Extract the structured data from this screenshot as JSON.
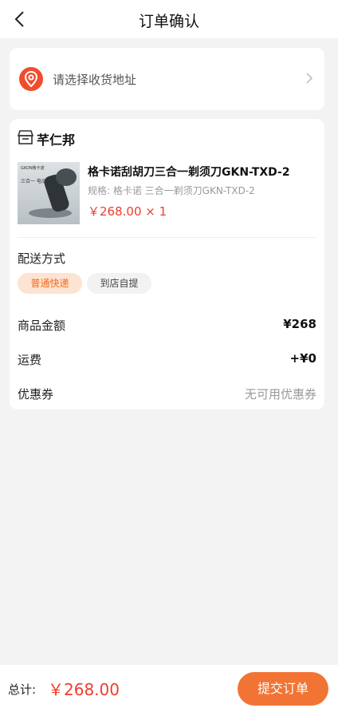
{
  "header": {
    "title": "订单确认"
  },
  "address": {
    "placeholder": "请选择收货地址"
  },
  "shop": {
    "name": "芊仁邦"
  },
  "product": {
    "thumb_brand": "GKON格卡诺",
    "thumb_caption": "三合一 电动剃须刀",
    "title": "格卡诺刮胡刀三合一剃须刀GKN-TXD-2",
    "spec": "规格:  格卡诺 三合一剃须刀GKN-TXD-2",
    "price_qty": "￥268.00  × 1"
  },
  "shipping": {
    "label": "配送方式",
    "options": [
      "普通快递",
      "到店自提"
    ],
    "selected": "普通快递"
  },
  "summary": [
    {
      "label": "商品金额",
      "value": "¥268"
    },
    {
      "label": "运费",
      "value": "+¥0"
    },
    {
      "label": "优惠券",
      "value": "无可用优惠券"
    }
  ],
  "footer": {
    "total_label": "总计:",
    "total_value": "￥268.00",
    "submit_label": "提交订单"
  },
  "colors": {
    "accent": "#ef3d2c",
    "button": "#f27434",
    "chip_selected_bg": "#fde3d1"
  }
}
